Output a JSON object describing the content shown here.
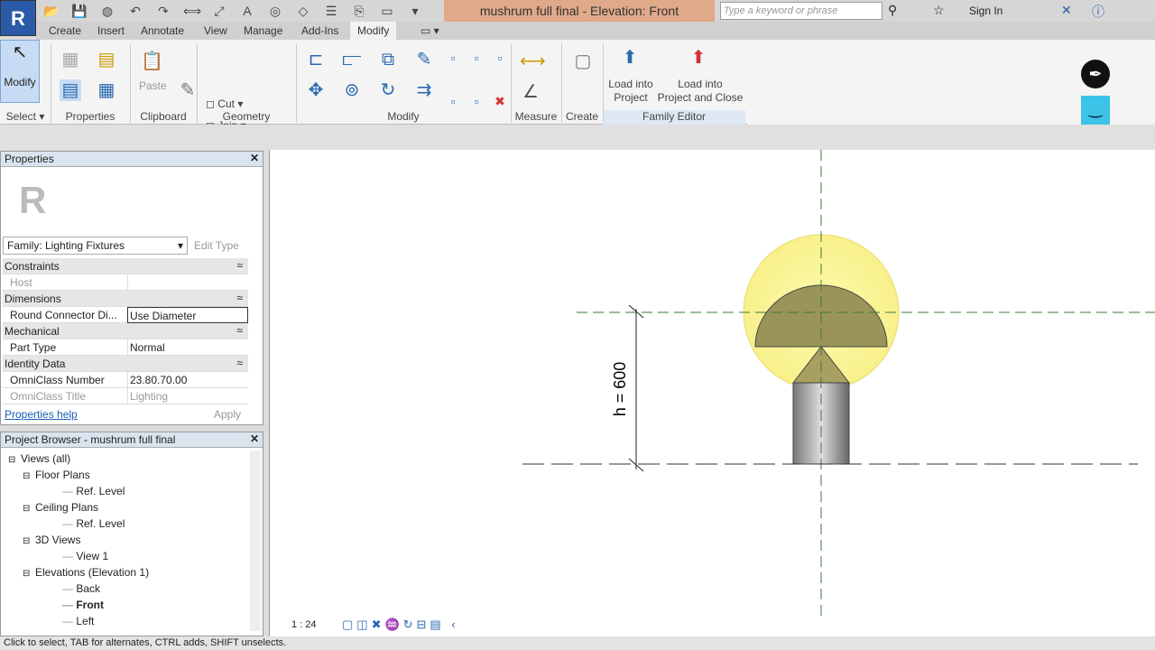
{
  "app": {
    "logo": "R",
    "title": "mushrum full final - Elevation: Front"
  },
  "search": {
    "placeholder": "Type a keyword or phrase"
  },
  "account": {
    "sign_in": "Sign In"
  },
  "tabs": [
    "Create",
    "Insert",
    "Annotate",
    "View",
    "Manage",
    "Add-Ins",
    "Modify"
  ],
  "active_tab": "Modify",
  "ribbon": {
    "modify_btn": "Modify",
    "cut": "Cut",
    "join": "Join",
    "paste": "Paste",
    "load_into_project": [
      "Load into",
      "Project"
    ],
    "load_and_close": [
      "Load into",
      "Project and Close"
    ],
    "panels": [
      "Select",
      "Properties",
      "Clipboard",
      "Geometry",
      "Modify",
      "Measure",
      "Create",
      "Family Editor"
    ]
  },
  "properties": {
    "title": "Properties",
    "type_selector": "Family: Lighting Fixtures",
    "edit_type": "Edit Type",
    "rows": [
      {
        "cat": "Constraints"
      },
      {
        "k": "Host",
        "v": "",
        "dim": true
      },
      {
        "cat": "Dimensions"
      },
      {
        "k": "Round Connector Di...",
        "v": "Use Diameter"
      },
      {
        "cat": "Mechanical"
      },
      {
        "k": "Part Type",
        "v": "Normal"
      },
      {
        "cat": "Identity Data"
      },
      {
        "k": "OmniClass Number",
        "v": "23.80.70.00"
      },
      {
        "k": "OmniClass Title",
        "v": "Lighting",
        "dim": true
      }
    ],
    "help": "Properties help",
    "apply": "Apply"
  },
  "browser": {
    "title": "Project Browser - mushrum full final",
    "items": [
      {
        "t": "Views (all)",
        "lvl": 0,
        "exp": "-"
      },
      {
        "t": "Floor Plans",
        "lvl": 1,
        "exp": "-"
      },
      {
        "t": "Ref. Level",
        "lvl": 2
      },
      {
        "t": "Ceiling Plans",
        "lvl": 1,
        "exp": "-"
      },
      {
        "t": "Ref. Level",
        "lvl": 2
      },
      {
        "t": "3D Views",
        "lvl": 1,
        "exp": "-"
      },
      {
        "t": "View 1",
        "lvl": 2
      },
      {
        "t": "Elevations (Elevation 1)",
        "lvl": 1,
        "exp": "-"
      },
      {
        "t": "Back",
        "lvl": 2
      },
      {
        "t": "Front",
        "lvl": 2,
        "bold": true
      },
      {
        "t": "Left",
        "lvl": 2
      }
    ]
  },
  "view": {
    "scale": "1 : 24",
    "dimension": "h = 600"
  },
  "status": "Click to select, TAB for alternates, CTRL adds, SHIFT unselects."
}
